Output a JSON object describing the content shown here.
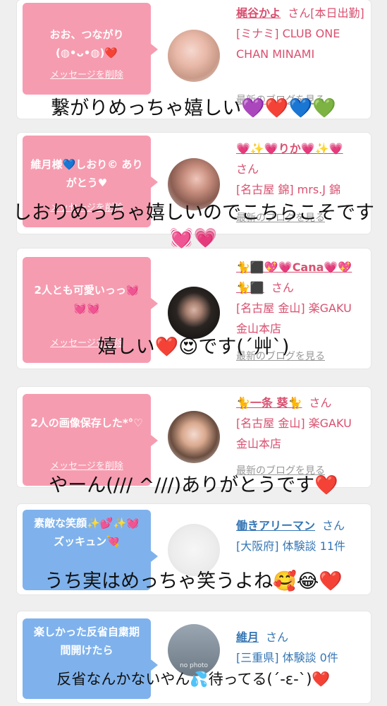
{
  "delete_label": "メッセージを削除",
  "blog_label": "最新のブログを見る",
  "san": "さん",
  "cards": [
    {
      "message": "おお、つながり (◍•ᴗ•◍)❤️",
      "name": "梶谷かよ",
      "status": "[本日出勤]",
      "line2": "[ミナミ] CLUB ONE CHAN MINAMI",
      "overlay": "繋がりめっちゃ嬉しい💜❤️💙💚"
    },
    {
      "message": "維月様💙しおり© ありがとう♥",
      "name": "💗✨💗りか💗✨💗",
      "status": "",
      "line2": "[名古屋 錦] mrs.J 錦",
      "overlay": "しおりめっちゃ嬉しいのでこちらこそです💓💗"
    },
    {
      "message": "2人とも可愛いっっ💓💓💓",
      "name": "🐈⬛💖💗Cana💗💖🐈⬛",
      "status": "",
      "line2": "[名古屋 金山] 楽GAKU 金山本店",
      "overlay": "嬉しい❤️😍です(´艸`)"
    },
    {
      "message": "2人の画像保存した*°♡",
      "name": "🐈一条 葵🐈",
      "status": "",
      "line2": "[名古屋 金山] 楽GAKU 金山本店",
      "overlay": "やーん(/// ^///)ありがとうです❤️"
    },
    {
      "message": "素敵な笑顔✨💕✨💓ズッキュン💘",
      "name": "働きアリーマン",
      "status": "",
      "line2": "[大阪府] 体験談 11件",
      "overlay": "うち実はめっちゃ笑うよね🥰😂❤️"
    },
    {
      "message": "楽しかった反省自粛期間開けたら",
      "name": "維月",
      "status": "",
      "line2": "[三重県] 体験談 0件",
      "avatar_text": "no photo",
      "overlay": "反省なんかないやん💦待ってる(´-ε-`)❤️"
    }
  ],
  "colors": {
    "pink_bubble": "#f69cb0",
    "blue_bubble": "#7fb2ec",
    "pink_text": "#d9506f",
    "blue_text": "#3576b5"
  }
}
